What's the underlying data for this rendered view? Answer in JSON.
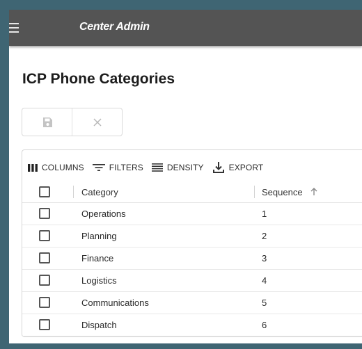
{
  "app": {
    "title": "Center Admin"
  },
  "page": {
    "title": "ICP Phone Categories"
  },
  "grid_toolbar": {
    "columns_label": "COLUMNS",
    "filters_label": "FILTERS",
    "density_label": "DENSITY",
    "export_label": "EXPORT"
  },
  "table": {
    "columns": [
      "Category",
      "Sequence"
    ],
    "sort": {
      "column": "Sequence",
      "direction": "ascending"
    },
    "rows": [
      {
        "category": "Operations",
        "sequence": "1"
      },
      {
        "category": "Planning",
        "sequence": "2"
      },
      {
        "category": "Finance",
        "sequence": "3"
      },
      {
        "category": "Logistics",
        "sequence": "4"
      },
      {
        "category": "Communications",
        "sequence": "5"
      },
      {
        "category": "Dispatch",
        "sequence": "6"
      }
    ]
  },
  "colors": {
    "background": "#3f6573",
    "appbar": "#545454",
    "icon_muted": "#c4c4c4"
  },
  "icons": [
    "menu-icon",
    "save-icon",
    "close-icon",
    "columns-icon",
    "filter-icon",
    "density-icon",
    "export-icon",
    "sort-ascending-icon"
  ]
}
